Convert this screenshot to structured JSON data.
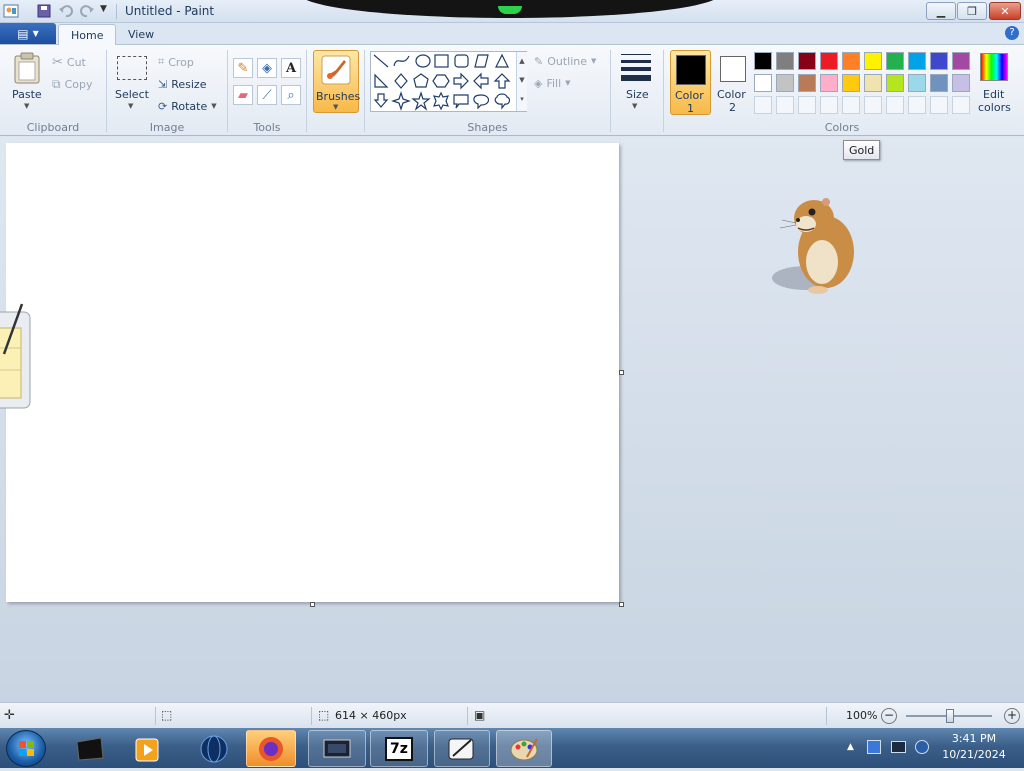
{
  "window": {
    "title": "Untitled - Paint"
  },
  "tabs": {
    "file_icon": "file-menu-icon",
    "home": "Home",
    "view": "View"
  },
  "clipboard": {
    "paste": "Paste",
    "cut": "Cut",
    "copy": "Copy",
    "label": "Clipboard"
  },
  "image": {
    "select": "Select",
    "crop": "Crop",
    "resize": "Resize",
    "rotate": "Rotate",
    "label": "Image"
  },
  "tools": {
    "label": "Tools",
    "text_tool": "A"
  },
  "brushes": {
    "label": "Brushes"
  },
  "shapes": {
    "outline": "Outline",
    "fill": "Fill",
    "label": "Shapes"
  },
  "size": {
    "label": "Size"
  },
  "colors": {
    "color1_line1": "Color",
    "color1_line2": "1",
    "color2_line1": "Color",
    "color2_line2": "2",
    "edit_line1": "Edit",
    "edit_line2": "colors",
    "label": "Colors",
    "color1_value": "#000000",
    "color2_value": "#ffffff",
    "palette_row1": [
      "#000000",
      "#7f7f7f",
      "#880015",
      "#ed1c24",
      "#ff7f27",
      "#fff200",
      "#22b14c",
      "#00a2e8",
      "#3f48cc",
      "#a349a4"
    ],
    "palette_row2": [
      "#ffffff",
      "#c3c3c3",
      "#b97a57",
      "#ffaec9",
      "#ffc90e",
      "#efe4b0",
      "#b5e61d",
      "#99d9ea",
      "#7092be",
      "#c8bfe7"
    ]
  },
  "tooltip": {
    "text": "Gold"
  },
  "status": {
    "dimensions": "614 × 460px",
    "zoom": "100%"
  },
  "taskbar": {
    "time": "3:41 PM",
    "date": "10/21/2024"
  }
}
